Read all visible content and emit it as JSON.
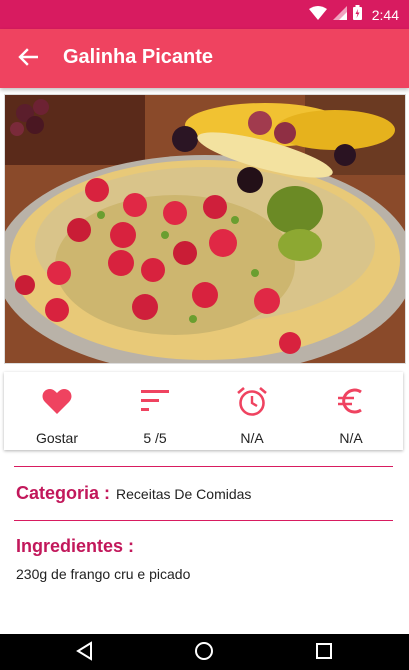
{
  "status_bar": {
    "time": "2:44",
    "icons": [
      "wifi-icon",
      "signal-icon",
      "battery-icon"
    ]
  },
  "app_bar": {
    "title": "Galinha Picante",
    "back_icon": "arrow-back-icon"
  },
  "photo": {
    "description_icon": "recipe-photo"
  },
  "actions": [
    {
      "icon": "heart-icon",
      "label": "Gostar"
    },
    {
      "icon": "sort-icon",
      "label": "5 /5"
    },
    {
      "icon": "alarm-clock-icon",
      "label": "N/A"
    },
    {
      "icon": "euro-icon",
      "label": "N/A"
    }
  ],
  "category": {
    "label": "Categoria :",
    "value": "Receitas De Comidas"
  },
  "ingredients": {
    "title": "Ingredientes :",
    "first_line": "230g de frango cru e picado"
  },
  "nav_bar": {
    "icons": [
      "back-triangle-icon",
      "home-circle-icon",
      "recents-square-icon"
    ]
  },
  "colors": {
    "status_bar": "#d81b60",
    "app_bar": "#ef4360",
    "accent": "#ef4360",
    "heading": "#c2185b"
  }
}
